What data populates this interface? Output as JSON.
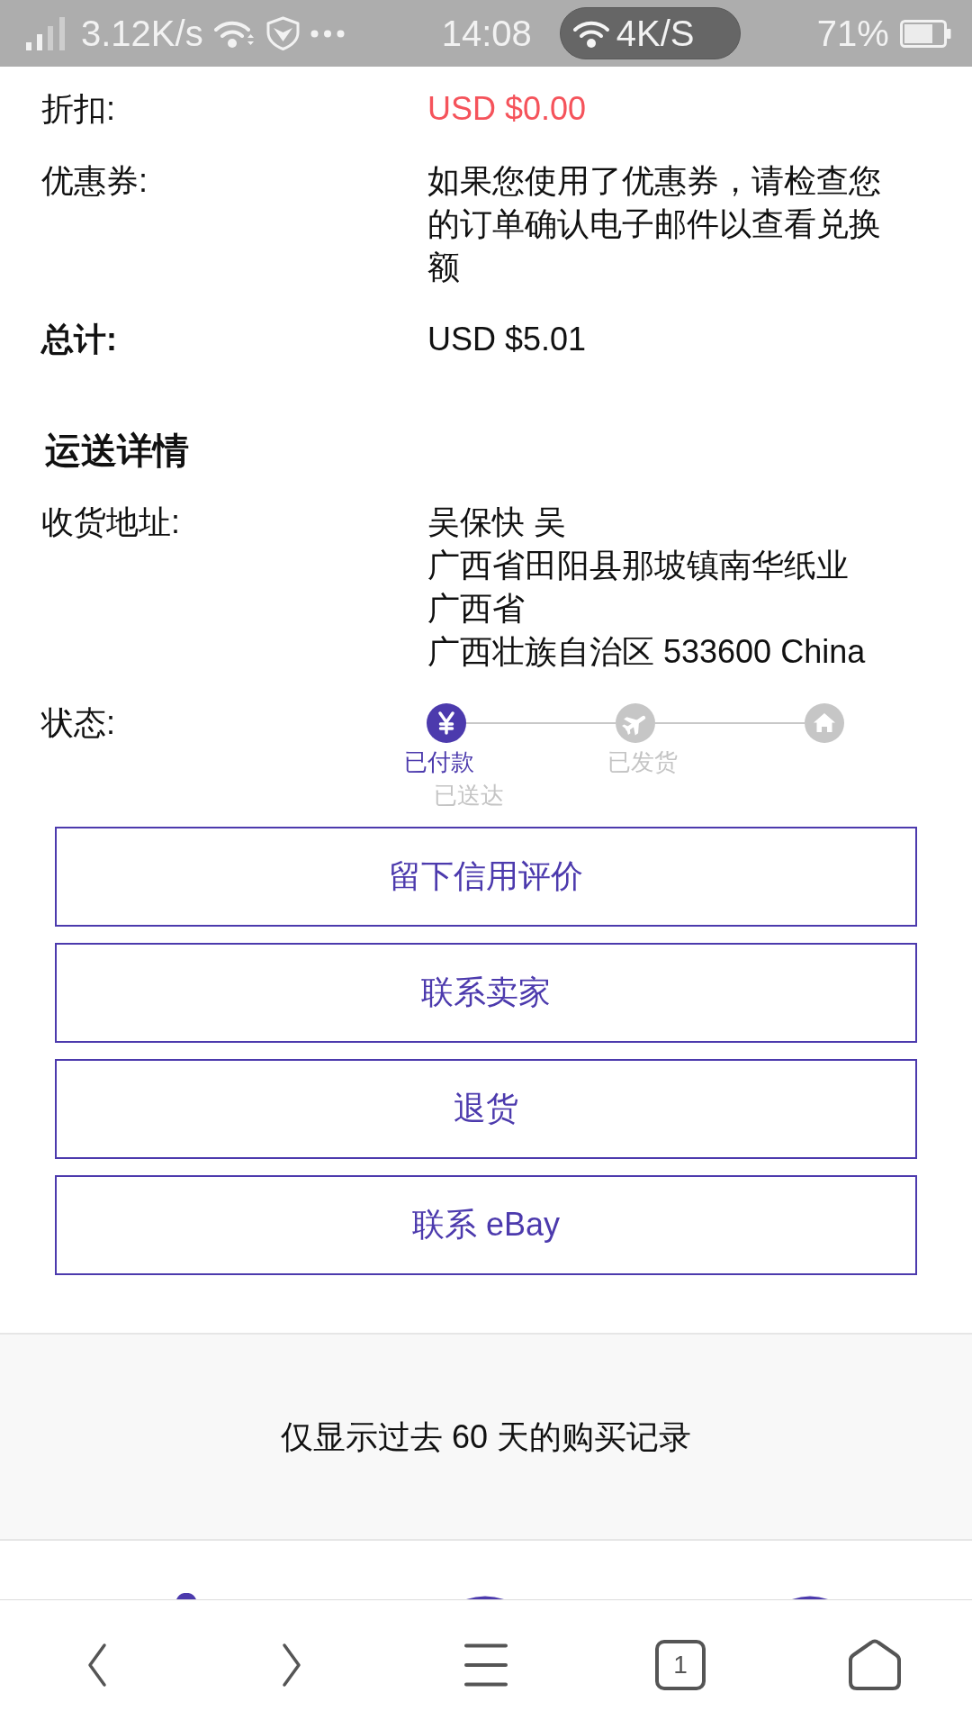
{
  "status_bar": {
    "network_speed": "3.12K/s",
    "time": "14:08",
    "hotspot_speed": "4K/S",
    "battery": "71%"
  },
  "order_summary": [
    {
      "label": "折扣:",
      "value": "USD $0.00",
      "kind": "discount"
    },
    {
      "label": "优惠券:",
      "value": "如果您使用了优惠券，请检查您的订单确认电子邮件以查看兑换额",
      "kind": "note"
    },
    {
      "label": "总计:",
      "value": "USD $5.01",
      "kind": "total"
    }
  ],
  "shipping": {
    "heading": "运送详情",
    "address_label": "收货地址:",
    "address_lines": [
      "吴保快 吴",
      "广西省田阳县那坡镇南华纸业",
      "广西省",
      "广西壮族自治区 533600 China"
    ],
    "status_label": "状态:",
    "steps": [
      {
        "label": "已付款",
        "kind": "paid",
        "completed": true
      },
      {
        "label": "已发货",
        "kind": "shipped",
        "completed": false
      },
      {
        "label": "已送达",
        "kind": "delivered",
        "completed": false
      }
    ]
  },
  "actions": [
    "留下信用评价",
    "联系卖家",
    "退货",
    "联系 eBay"
  ],
  "footer_note": "仅显示过去 60 天的购买记录",
  "browser_toolbar": {
    "tab_count": "1"
  }
}
